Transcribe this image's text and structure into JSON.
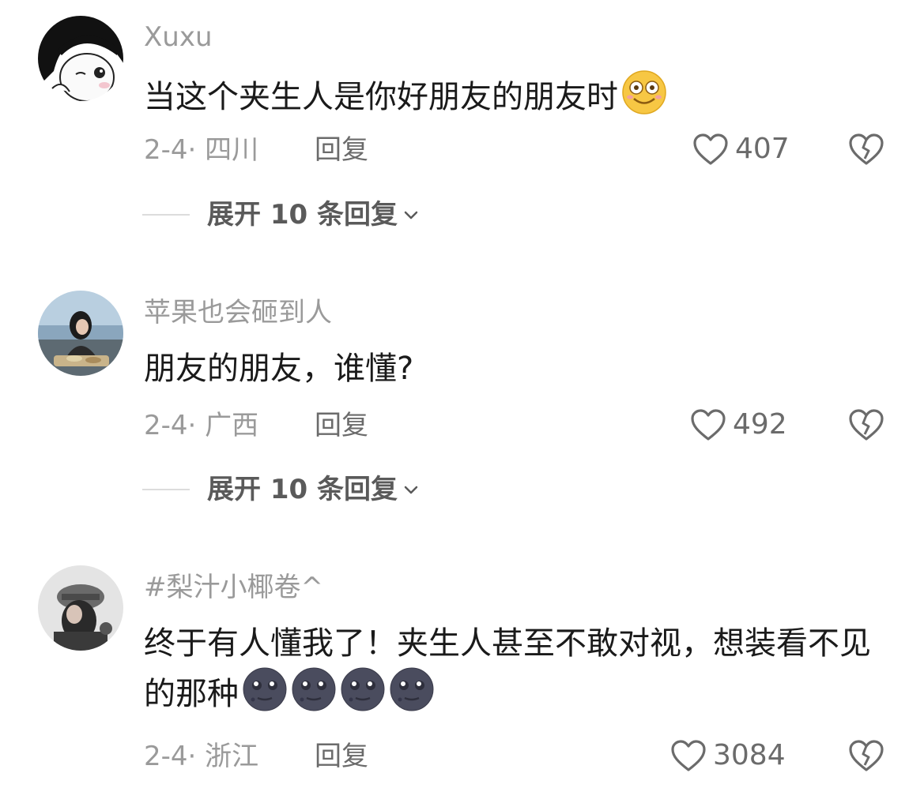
{
  "comments": [
    {
      "username": "Xuxu",
      "text": "当这个夹生人是你好朋友的朋友时",
      "emojis": [
        "smile-emoji"
      ],
      "meta": "2-4· 四川",
      "reply_label": "回复",
      "likes": "407",
      "expand_label": "展开 10 条回复"
    },
    {
      "username": "苹果也会砸到人",
      "text": "朋友的朋友，谁懂?",
      "emojis": [],
      "meta": "2-4· 广西",
      "reply_label": "回复",
      "likes": "492",
      "expand_label": "展开 10 条回复"
    },
    {
      "username": "#梨汁小椰卷^",
      "text": "终于有人懂我了！夹生人甚至不敢对视，想装看不见的那种",
      "emojis": [
        "new-moon-face-emoji",
        "new-moon-face-emoji",
        "new-moon-face-emoji",
        "new-moon-face-emoji"
      ],
      "meta": "2-4· 浙江",
      "reply_label": "回复",
      "likes": "3084"
    }
  ],
  "icons": {
    "like": "heart-outline-icon",
    "dislike": "broken-heart-icon",
    "expand": "chevron-down-icon"
  },
  "colors": {
    "username": "#9a9a9a",
    "text": "#1a1a1a",
    "secondary": "#6b6b6b"
  }
}
